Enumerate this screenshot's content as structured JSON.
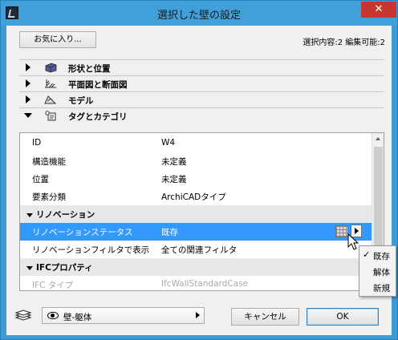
{
  "window": {
    "title": "選択した壁の設定",
    "close_glyph": "✕"
  },
  "header": {
    "favorites_label": "お気に入り...",
    "selection_info": "選択内容:2 編集可能:2"
  },
  "sections": [
    {
      "label": "形状と位置",
      "icon": "wall-geometry-icon",
      "expanded": false
    },
    {
      "label": "平面図と断面図",
      "icon": "floorplan-section-icon",
      "expanded": false
    },
    {
      "label": "モデル",
      "icon": "model-icon",
      "expanded": false
    },
    {
      "label": "タグとカテゴリ",
      "icon": "tag-category-icon",
      "expanded": true
    }
  ],
  "table": {
    "rows": [
      {
        "key": "ID",
        "value": "W4"
      },
      {
        "key": "構造機能",
        "value": "未定義"
      },
      {
        "key": "位置",
        "value": "未定義"
      },
      {
        "key": "要素分類",
        "value": "ArchiCADタイプ"
      },
      {
        "group": "リノベーション"
      },
      {
        "key": "リノベーションステータス",
        "value": "既存",
        "selected": true
      },
      {
        "key": "リノベーションフィルタで表示",
        "value": "全ての関連フィルタ"
      },
      {
        "group": "IFCプロパティ"
      },
      {
        "key": "IFC タイプ",
        "value": "IfcWallStandardCase",
        "disabled": true
      }
    ]
  },
  "popup_menu": {
    "items": [
      {
        "label": "既存",
        "checked": true
      },
      {
        "label": "解体",
        "checked": false
      },
      {
        "label": "新規",
        "checked": false
      }
    ]
  },
  "footer": {
    "layer_value": "壁-躯体",
    "cancel_label": "キャンセル",
    "ok_label": "OK"
  },
  "colors": {
    "titlebar": "#41a0da",
    "selection": "#3399ff",
    "close": "#c7372f"
  }
}
